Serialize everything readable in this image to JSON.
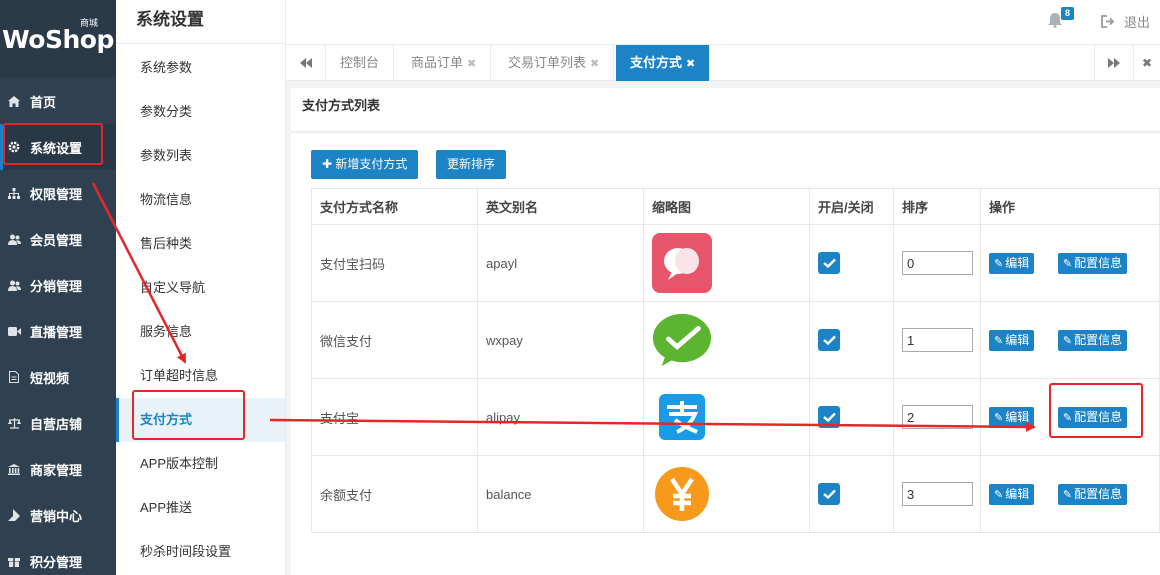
{
  "brand": {
    "logo": "WoShop",
    "badge": "商城"
  },
  "nav": [
    {
      "label": "首页",
      "icon": "home-icon"
    },
    {
      "label": "系统设置",
      "icon": "gear-icon"
    },
    {
      "label": "权限管理",
      "icon": "sitemap-icon"
    },
    {
      "label": "会员管理",
      "icon": "users-icon"
    },
    {
      "label": "分销管理",
      "icon": "users-icon"
    },
    {
      "label": "直播管理",
      "icon": "video-icon"
    },
    {
      "label": "短视频",
      "icon": "file-icon"
    },
    {
      "label": "自营店铺",
      "icon": "scale-icon"
    },
    {
      "label": "商家管理",
      "icon": "bank-icon"
    },
    {
      "label": "营销中心",
      "icon": "tag-icon"
    },
    {
      "label": "积分管理",
      "icon": "gift-icon"
    }
  ],
  "submenu": {
    "title": "系统设置",
    "items": [
      "系统参数",
      "参数分类",
      "参数列表",
      "物流信息",
      "售后种类",
      "自定义导航",
      "服务信息",
      "订单超时信息",
      "支付方式",
      "APP版本控制",
      "APP推送",
      "秒杀时间段设置"
    ]
  },
  "header": {
    "notify_count": "8",
    "logout": "退出"
  },
  "tabs": [
    {
      "label": "控制台",
      "closable": false
    },
    {
      "label": "商品订单",
      "closable": true
    },
    {
      "label": "交易订单列表",
      "closable": true
    },
    {
      "label": "支付方式",
      "closable": true
    }
  ],
  "panel": {
    "title": "支付方式列表",
    "add_button": "新增支付方式",
    "sort_button": "更新排序",
    "columns": [
      "支付方式名称",
      "英文别名",
      "缩略图",
      "开启/关闭",
      "排序",
      "操作"
    ],
    "rows": [
      {
        "name": "支付宝扫码",
        "alias": "apayl",
        "thumb": "alipay-scan-logo-icon",
        "enabled": true,
        "sort": "0"
      },
      {
        "name": "微信支付",
        "alias": "wxpay",
        "thumb": "wechat-pay-logo-icon",
        "enabled": true,
        "sort": "1"
      },
      {
        "name": "支付宝",
        "alias": "alipay",
        "thumb": "alipay-logo-icon",
        "enabled": true,
        "sort": "2"
      },
      {
        "name": "余额支付",
        "alias": "balance",
        "thumb": "yen-coin-icon",
        "enabled": true,
        "sort": "3"
      }
    ],
    "edit_label": "编辑",
    "config_label": "配置信息"
  },
  "colors": {
    "accent": "#1c84c6",
    "sidebar": "#2f4050",
    "annotation": "#e8262a"
  }
}
